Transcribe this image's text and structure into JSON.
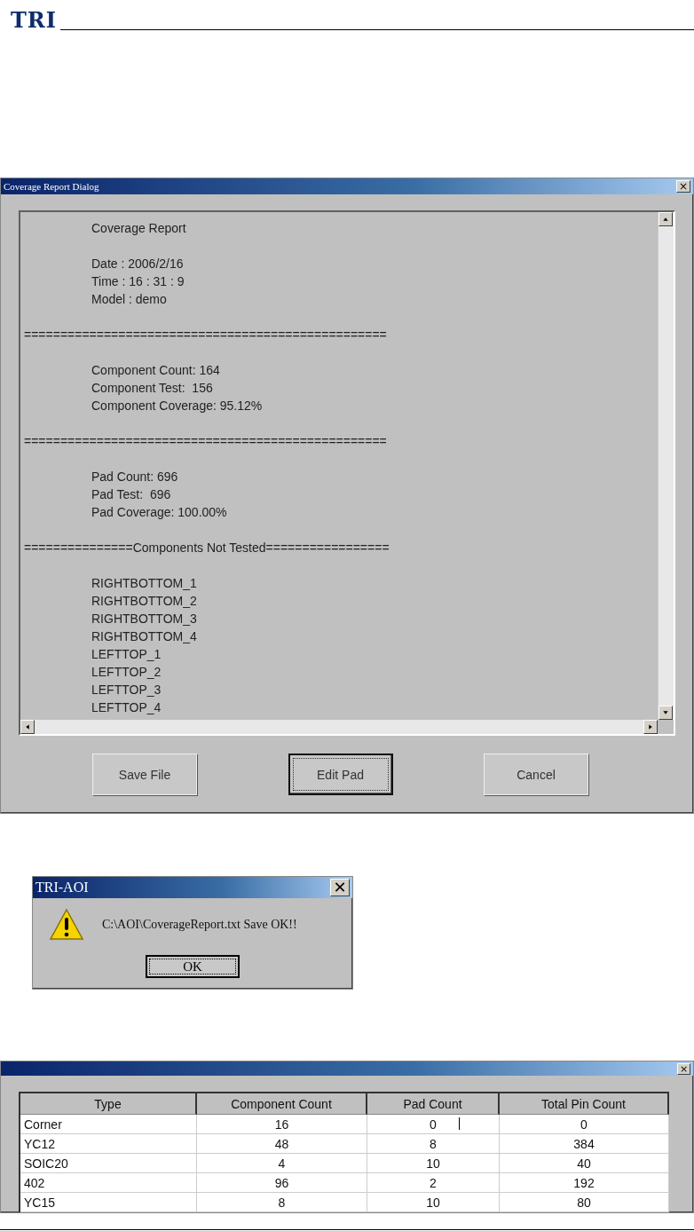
{
  "header": {
    "logo": "TRI"
  },
  "report_dialog": {
    "title": "Coverage Report Dialog",
    "close": "×",
    "lines": [
      {
        "kind": "text",
        "text": "Coverage Report"
      },
      {
        "kind": "blank"
      },
      {
        "kind": "text",
        "text": "Date : 2006/2/16"
      },
      {
        "kind": "text",
        "text": "Time : 16 : 31 : 9"
      },
      {
        "kind": "text",
        "text": "Model : demo"
      },
      {
        "kind": "blank"
      },
      {
        "kind": "rule",
        "text": "=================================================="
      },
      {
        "kind": "blank"
      },
      {
        "kind": "text",
        "text": "Component Count: 164"
      },
      {
        "kind": "text",
        "text": "Component Test:  156"
      },
      {
        "kind": "text",
        "text": "Component Coverage: 95.12%"
      },
      {
        "kind": "blank"
      },
      {
        "kind": "rule",
        "text": "=================================================="
      },
      {
        "kind": "blank"
      },
      {
        "kind": "text",
        "text": "Pad Count: 696"
      },
      {
        "kind": "text",
        "text": "Pad Test:  696"
      },
      {
        "kind": "text",
        "text": "Pad Coverage: 100.00%"
      },
      {
        "kind": "blank"
      },
      {
        "kind": "rule",
        "text": "===============Components Not Tested================="
      },
      {
        "kind": "blank"
      },
      {
        "kind": "text",
        "text": "RIGHTBOTTOM_1"
      },
      {
        "kind": "text",
        "text": "RIGHTBOTTOM_2"
      },
      {
        "kind": "text",
        "text": "RIGHTBOTTOM_3"
      },
      {
        "kind": "text",
        "text": "RIGHTBOTTOM_4"
      },
      {
        "kind": "text",
        "text": "LEFTTOP_1"
      },
      {
        "kind": "text",
        "text": "LEFTTOP_2"
      },
      {
        "kind": "text",
        "text": "LEFTTOP_3"
      },
      {
        "kind": "text",
        "text": "LEFTTOP_4"
      }
    ],
    "buttons": [
      {
        "label": "Save File",
        "focused": false
      },
      {
        "label": "Edit Pad",
        "focused": true
      },
      {
        "label": "Cancel",
        "focused": false
      }
    ]
  },
  "message_box": {
    "title": "TRI-AOI",
    "close": "✕",
    "message": "C:\\AOI\\CoverageReport.txt Save OK!!",
    "button": {
      "label": "OK",
      "focused": true
    }
  },
  "pad_dialog": {
    "close": "×",
    "columns": [
      "Type",
      "Component Count",
      "Pad Count",
      "Total Pin Count"
    ],
    "rows": [
      [
        "Corner",
        "16",
        "0",
        "0"
      ],
      [
        "YC12",
        "48",
        "8",
        "384"
      ],
      [
        "SOIC20",
        "4",
        "10",
        "40"
      ],
      [
        "402",
        "96",
        "2",
        "192"
      ],
      [
        "YC15",
        "8",
        "10",
        "80"
      ]
    ]
  }
}
